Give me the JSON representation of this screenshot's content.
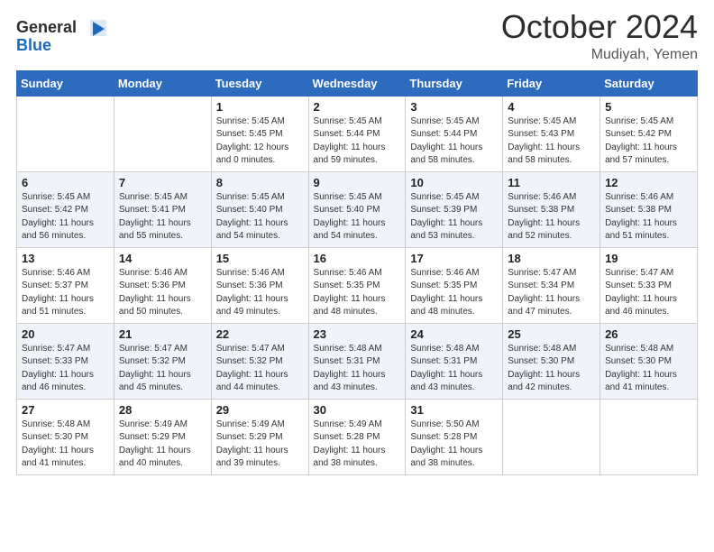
{
  "logo": {
    "line1": "General",
    "line2": "Blue"
  },
  "header": {
    "month": "October 2024",
    "location": "Mudiyah, Yemen"
  },
  "weekdays": [
    "Sunday",
    "Monday",
    "Tuesday",
    "Wednesday",
    "Thursday",
    "Friday",
    "Saturday"
  ],
  "weeks": [
    [
      {
        "day": "",
        "info": ""
      },
      {
        "day": "",
        "info": ""
      },
      {
        "day": "1",
        "info": "Sunrise: 5:45 AM\nSunset: 5:45 PM\nDaylight: 12 hours\nand 0 minutes."
      },
      {
        "day": "2",
        "info": "Sunrise: 5:45 AM\nSunset: 5:44 PM\nDaylight: 11 hours\nand 59 minutes."
      },
      {
        "day": "3",
        "info": "Sunrise: 5:45 AM\nSunset: 5:44 PM\nDaylight: 11 hours\nand 58 minutes."
      },
      {
        "day": "4",
        "info": "Sunrise: 5:45 AM\nSunset: 5:43 PM\nDaylight: 11 hours\nand 58 minutes."
      },
      {
        "day": "5",
        "info": "Sunrise: 5:45 AM\nSunset: 5:42 PM\nDaylight: 11 hours\nand 57 minutes."
      }
    ],
    [
      {
        "day": "6",
        "info": "Sunrise: 5:45 AM\nSunset: 5:42 PM\nDaylight: 11 hours\nand 56 minutes."
      },
      {
        "day": "7",
        "info": "Sunrise: 5:45 AM\nSunset: 5:41 PM\nDaylight: 11 hours\nand 55 minutes."
      },
      {
        "day": "8",
        "info": "Sunrise: 5:45 AM\nSunset: 5:40 PM\nDaylight: 11 hours\nand 54 minutes."
      },
      {
        "day": "9",
        "info": "Sunrise: 5:45 AM\nSunset: 5:40 PM\nDaylight: 11 hours\nand 54 minutes."
      },
      {
        "day": "10",
        "info": "Sunrise: 5:45 AM\nSunset: 5:39 PM\nDaylight: 11 hours\nand 53 minutes."
      },
      {
        "day": "11",
        "info": "Sunrise: 5:46 AM\nSunset: 5:38 PM\nDaylight: 11 hours\nand 52 minutes."
      },
      {
        "day": "12",
        "info": "Sunrise: 5:46 AM\nSunset: 5:38 PM\nDaylight: 11 hours\nand 51 minutes."
      }
    ],
    [
      {
        "day": "13",
        "info": "Sunrise: 5:46 AM\nSunset: 5:37 PM\nDaylight: 11 hours\nand 51 minutes."
      },
      {
        "day": "14",
        "info": "Sunrise: 5:46 AM\nSunset: 5:36 PM\nDaylight: 11 hours\nand 50 minutes."
      },
      {
        "day": "15",
        "info": "Sunrise: 5:46 AM\nSunset: 5:36 PM\nDaylight: 11 hours\nand 49 minutes."
      },
      {
        "day": "16",
        "info": "Sunrise: 5:46 AM\nSunset: 5:35 PM\nDaylight: 11 hours\nand 48 minutes."
      },
      {
        "day": "17",
        "info": "Sunrise: 5:46 AM\nSunset: 5:35 PM\nDaylight: 11 hours\nand 48 minutes."
      },
      {
        "day": "18",
        "info": "Sunrise: 5:47 AM\nSunset: 5:34 PM\nDaylight: 11 hours\nand 47 minutes."
      },
      {
        "day": "19",
        "info": "Sunrise: 5:47 AM\nSunset: 5:33 PM\nDaylight: 11 hours\nand 46 minutes."
      }
    ],
    [
      {
        "day": "20",
        "info": "Sunrise: 5:47 AM\nSunset: 5:33 PM\nDaylight: 11 hours\nand 46 minutes."
      },
      {
        "day": "21",
        "info": "Sunrise: 5:47 AM\nSunset: 5:32 PM\nDaylight: 11 hours\nand 45 minutes."
      },
      {
        "day": "22",
        "info": "Sunrise: 5:47 AM\nSunset: 5:32 PM\nDaylight: 11 hours\nand 44 minutes."
      },
      {
        "day": "23",
        "info": "Sunrise: 5:48 AM\nSunset: 5:31 PM\nDaylight: 11 hours\nand 43 minutes."
      },
      {
        "day": "24",
        "info": "Sunrise: 5:48 AM\nSunset: 5:31 PM\nDaylight: 11 hours\nand 43 minutes."
      },
      {
        "day": "25",
        "info": "Sunrise: 5:48 AM\nSunset: 5:30 PM\nDaylight: 11 hours\nand 42 minutes."
      },
      {
        "day": "26",
        "info": "Sunrise: 5:48 AM\nSunset: 5:30 PM\nDaylight: 11 hours\nand 41 minutes."
      }
    ],
    [
      {
        "day": "27",
        "info": "Sunrise: 5:48 AM\nSunset: 5:30 PM\nDaylight: 11 hours\nand 41 minutes."
      },
      {
        "day": "28",
        "info": "Sunrise: 5:49 AM\nSunset: 5:29 PM\nDaylight: 11 hours\nand 40 minutes."
      },
      {
        "day": "29",
        "info": "Sunrise: 5:49 AM\nSunset: 5:29 PM\nDaylight: 11 hours\nand 39 minutes."
      },
      {
        "day": "30",
        "info": "Sunrise: 5:49 AM\nSunset: 5:28 PM\nDaylight: 11 hours\nand 38 minutes."
      },
      {
        "day": "31",
        "info": "Sunrise: 5:50 AM\nSunset: 5:28 PM\nDaylight: 11 hours\nand 38 minutes."
      },
      {
        "day": "",
        "info": ""
      },
      {
        "day": "",
        "info": ""
      }
    ]
  ]
}
